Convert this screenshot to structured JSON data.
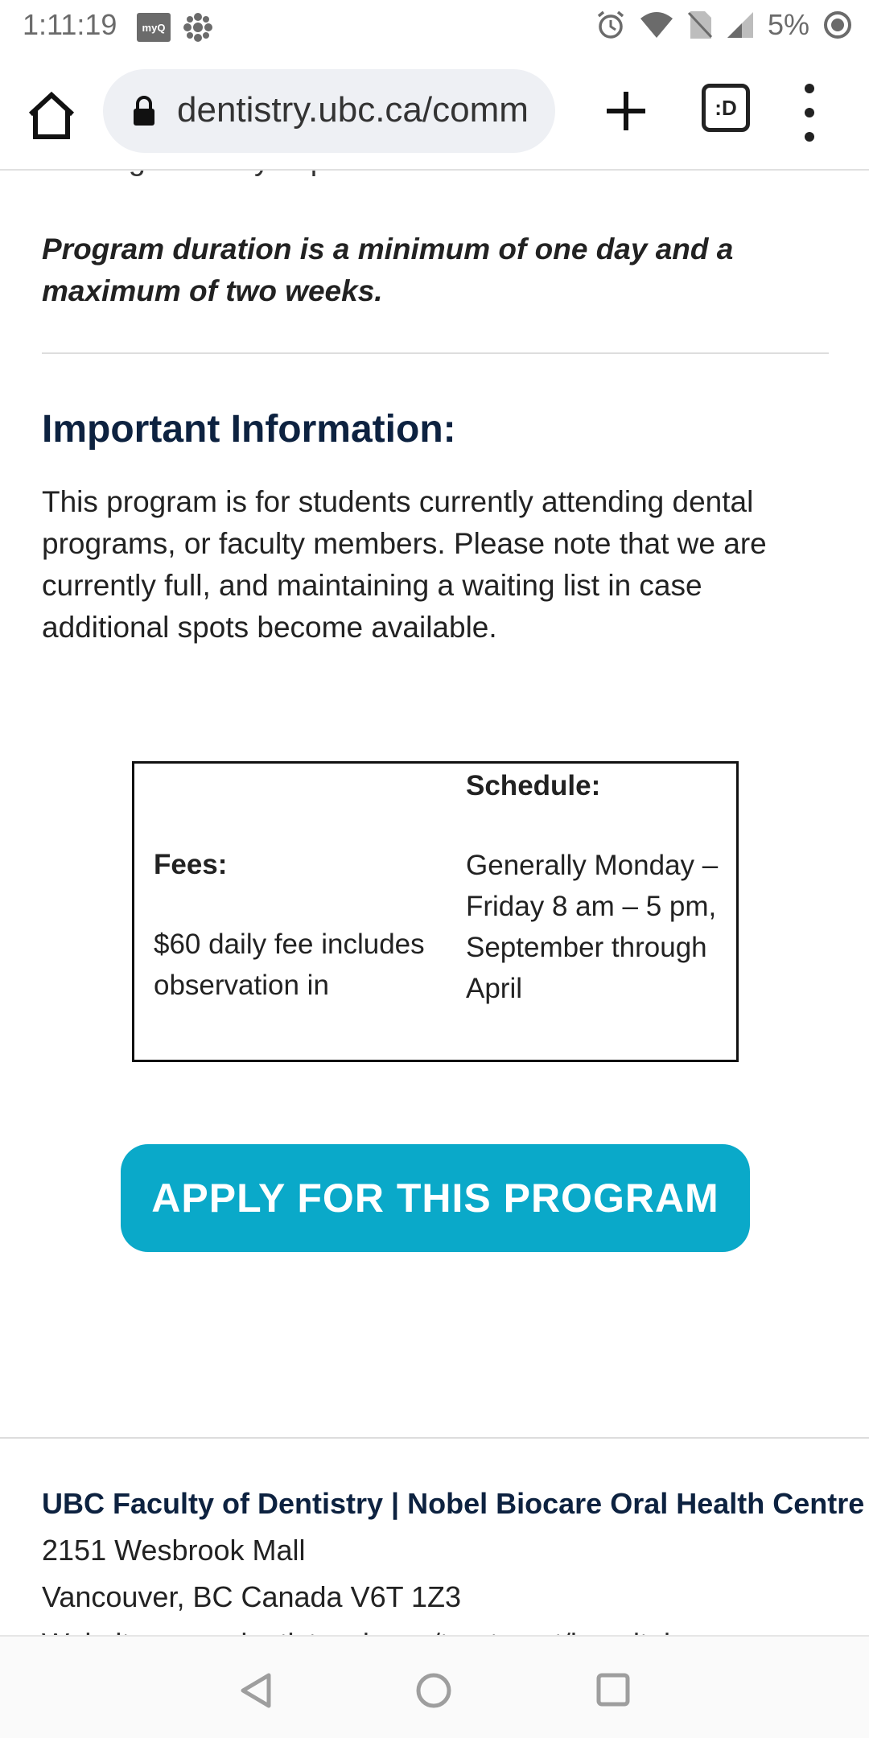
{
  "status_bar": {
    "time": "1:11:19",
    "myq_label": "myQ",
    "battery": "5%"
  },
  "browser": {
    "url": "dentistry.ubc.ca/comm",
    "tabs_label": ":D"
  },
  "content": {
    "cut_off_text": "existing dentistry experience.",
    "duration": "Program duration is a minimum of one day and a maximum of two weeks.",
    "important_title": "Important Information:",
    "important_body": "This program is for students currently attending dental programs, or faculty members.  Please note that we are currently full, and maintaining  a waiting list in case additional spots become available.",
    "table": {
      "fees_heading": "Fees:",
      "fees_text": "$60 daily fee includes observation in",
      "schedule_heading": "Schedule:",
      "schedule_text": "Generally Monday – Friday 8 am – 5 pm, September through April"
    },
    "apply_button": "APPLY FOR THIS PROGRAM"
  },
  "footer": {
    "title": "UBC Faculty of Dentistry | Nobel Biocare Oral Health Centre",
    "address_line1": "2151 Wesbrook Mall",
    "address_line2": "Vancouver, BC Canada V6T 1Z3",
    "website_line": "Website: www.dentistry.ubc.ca/treatment/hospital"
  },
  "colors": {
    "heading": "#0d2240",
    "apply_button": "#0aa9c9"
  }
}
